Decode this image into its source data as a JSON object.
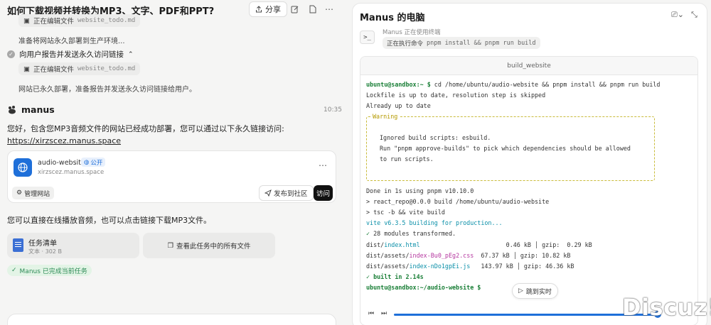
{
  "header": {
    "title": "如何下载视频并转换为MP3、文字、PDF和PPT?",
    "share_label": "分享"
  },
  "steps": {
    "chip1_label": "正在编辑文件",
    "chip1_file": "website_todo.md",
    "deploy_text": "准备将网站永久部署到生产环境...",
    "report_step": "向用户报告并发送永久访问链接",
    "chip2_label": "正在编辑文件",
    "chip2_file": "website_todo.md",
    "deployed_text": "网站已永久部署，准备报告并发送永久访问链接给用户。"
  },
  "reply": {
    "brand": "manus",
    "time": "10:35",
    "greeting": "您好，包含您MP3音频文件的网站已经成功部署，您可以通过以下永久链接访问:",
    "link": "https://xirzscez.manus.space",
    "card": {
      "site_name": "audio-website",
      "public_label": "公开",
      "site_url": "xirzscez.manus.space",
      "manage_label": "管理网站",
      "publish_label": "发布到社区",
      "visit_label": "访问"
    },
    "play_text": "您可以直接在线播放音频，也可以点击链接下载MP3文件。",
    "file": {
      "name": "任务清单",
      "meta": "文本 · 302 B"
    },
    "all_files_label": "查看此任务中的所有文件",
    "done_label": "Manus 已完成当前任务"
  },
  "computer": {
    "title": "Manus 的电脑",
    "using_text": "Manus 正在使用终端",
    "cmd_label": "正在执行命令",
    "cmd_value": "pnpm install && pnpm run build",
    "terminal_title": "build_website",
    "terminal": {
      "prompt1": "ubuntu@sandbox:~ $",
      "cmd1": " cd /home/ubuntu/audio-website && pnpm install && pnpm run build",
      "l2": "Lockfile is up to date, resolution step is skipped",
      "l3": "Already up to date",
      "warn_label": "Warning",
      "w1": "Ignored build scripts: esbuild.",
      "w2": "Run \"pnpm approve-builds\" to pick which dependencies should be allowed",
      "w3": "to run scripts.",
      "l4": "Done in 1s using pnpm v10.10.0",
      "l5": "> react_repo@0.0.0 build /home/ubuntu/audio-website",
      "l6": "> tsc -b && vite build",
      "l7": "vite v6.3.5 building for production...",
      "l8_mark": "✓",
      "l8": " 28 modules transformed.",
      "f1_dir": "dist/",
      "f1_name": "index.html",
      "f1_size": "                        0.46 kB │ gzip:  0.29 kB",
      "f2_dir": "dist/assets/",
      "f2_name": "index-Bu0_pEg2.css",
      "f2_size": "  67.37 kB │ gzip: 10.82 kB",
      "f3_dir": "dist/assets/",
      "f3_name": "index-nDo1gpEi.js",
      "f3_size": "   143.97 kB │ gzip: 46.36 kB",
      "l9": "✓ built in 2.14s",
      "prompt2": "ubuntu@sandbox:~/audio-website $"
    },
    "jump_label": "跳到实时",
    "progress": 1.0
  },
  "watermark": {
    "text": "Discuz!",
    "sup": "3"
  }
}
